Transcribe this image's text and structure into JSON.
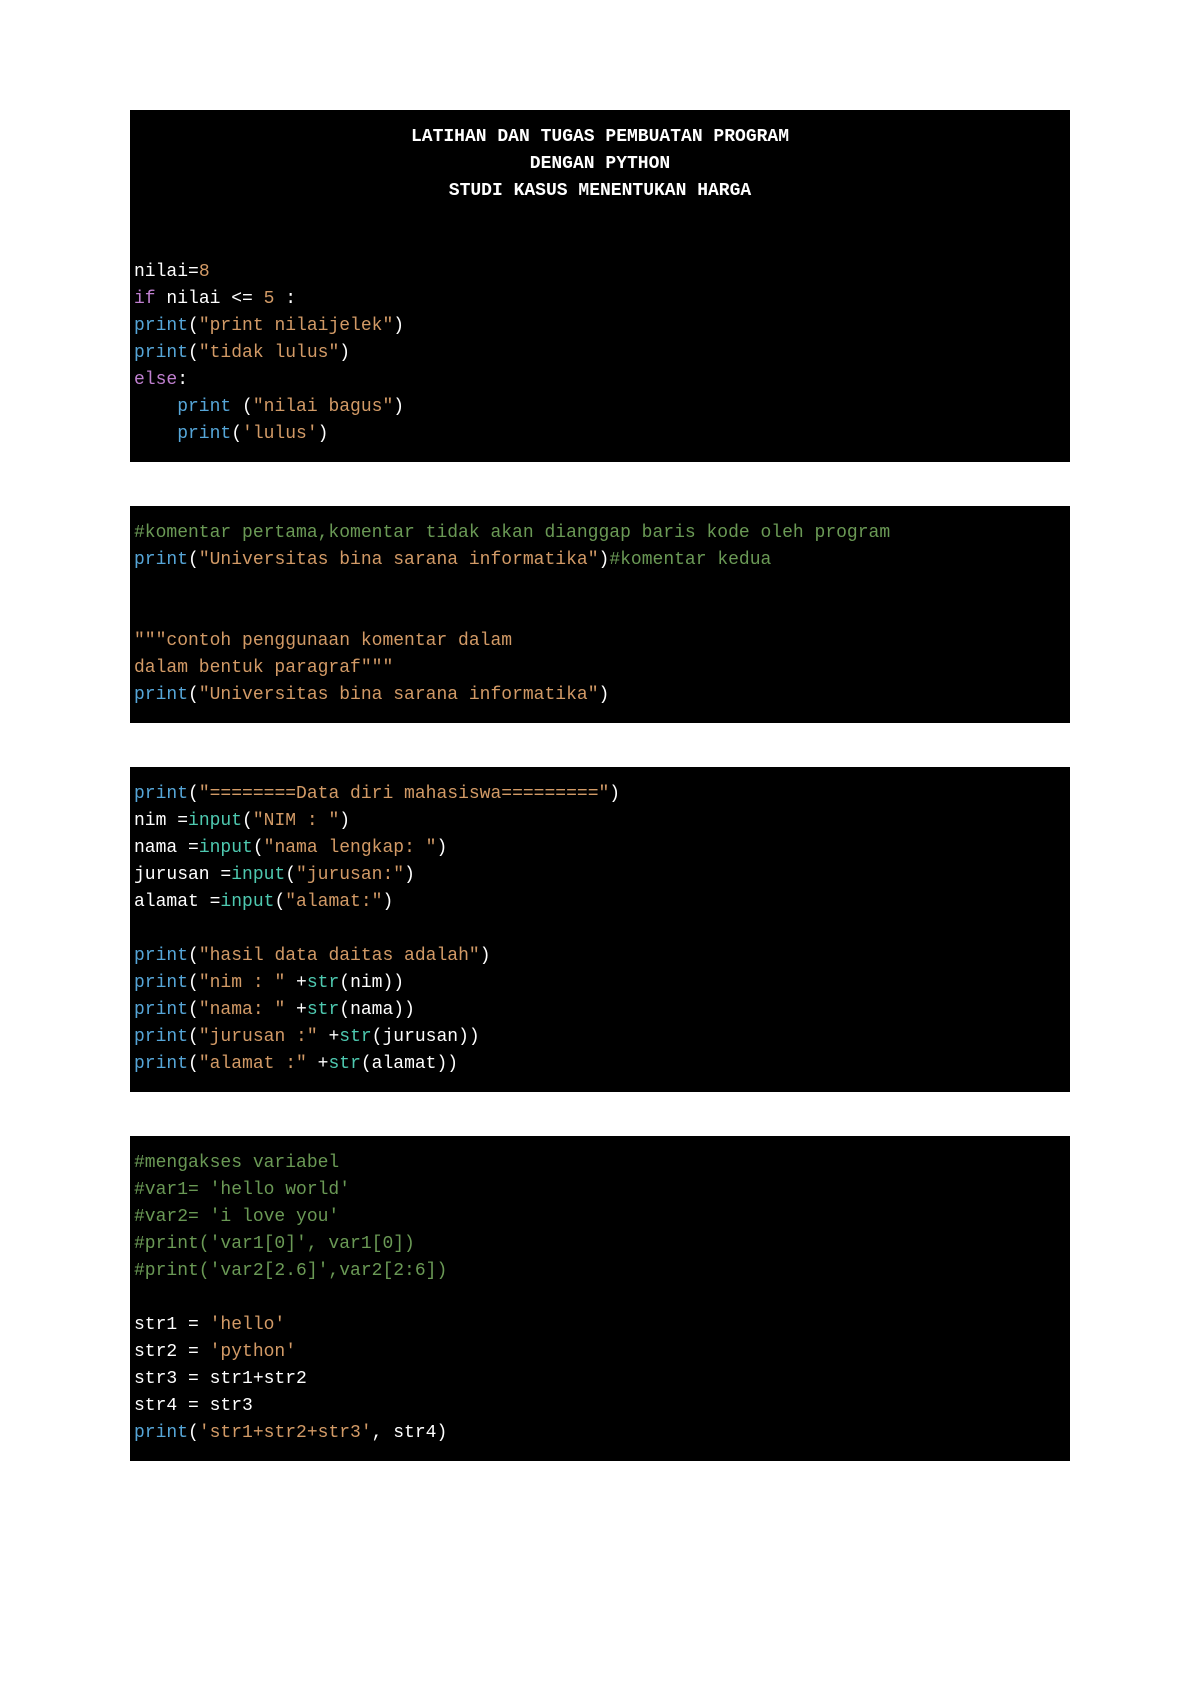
{
  "block1": {
    "title1": "LATIHAN DAN TUGAS PEMBUATAN PROGRAM",
    "title2": "DENGAN PYTHON",
    "title3": "STUDI KASUS MENENTUKAN HARGA",
    "l1_a": "nilai=",
    "l1_b": "8",
    "l2_a": "if",
    "l2_b": " nilai <= ",
    "l2_c": "5",
    "l2_d": " :",
    "l3_a": "print",
    "l3_b": "(",
    "l3_c": "\"print nilaijelek\"",
    "l3_d": ")",
    "l4_a": "print",
    "l4_b": "(",
    "l4_c": "\"tidak lulus\"",
    "l4_d": ")",
    "l5_a": "else",
    "l5_b": ":",
    "l6_a": "    print ",
    "l6_b": "(",
    "l6_c": "\"nilai bagus\"",
    "l6_d": ")",
    "l7_a": "    print",
    "l7_b": "(",
    "l7_c": "'lulus'",
    "l7_d": ")"
  },
  "block2": {
    "l1": "#komentar pertama,komentar tidak akan dianggap baris kode oleh program",
    "l2_a": "print",
    "l2_b": "(",
    "l2_c": "\"Universitas bina sarana informatika\"",
    "l2_d": ")",
    "l2_e": "#komentar kedua",
    "l3_a": "\"\"\"contoh penggunaan komentar dalam",
    "l4_a": "dalam bentuk paragraf\"\"\"",
    "l5_a": "print",
    "l5_b": "(",
    "l5_c": "\"Universitas bina sarana informatika\"",
    "l5_d": ")"
  },
  "block3": {
    "l1_a": "print",
    "l1_b": "(",
    "l1_c": "\"========Data diri mahasiswa=========\"",
    "l1_d": ")",
    "l2_a": "nim =",
    "l2_b": "input",
    "l2_c": "(",
    "l2_d": "\"NIM : \"",
    "l2_e": ")",
    "l3_a": "nama =",
    "l3_b": "input",
    "l3_c": "(",
    "l3_d": "\"nama lengkap: \"",
    "l3_e": ")",
    "l4_a": "jurusan =",
    "l4_b": "input",
    "l4_c": "(",
    "l4_d": "\"jurusan:\"",
    "l4_e": ")",
    "l5_a": "alamat =",
    "l5_b": "input",
    "l5_c": "(",
    "l5_d": "\"alamat:\"",
    "l5_e": ")",
    "l6_a": "print",
    "l6_b": "(",
    "l6_c": "\"hasil data daitas adalah\"",
    "l6_d": ")",
    "l7_a": "print",
    "l7_b": "(",
    "l7_c": "\"nim : \"",
    "l7_d": " +",
    "l7_e": "str",
    "l7_f": "(nim))",
    "l8_a": "print",
    "l8_b": "(",
    "l8_c": "\"nama: \"",
    "l8_d": " +",
    "l8_e": "str",
    "l8_f": "(nama))",
    "l9_a": "print",
    "l9_b": "(",
    "l9_c": "\"jurusan :\"",
    "l9_d": " +",
    "l9_e": "str",
    "l9_f": "(jurusan))",
    "l10_a": "print",
    "l10_b": "(",
    "l10_c": "\"alamat :\"",
    "l10_d": " +",
    "l10_e": "str",
    "l10_f": "(alamat))"
  },
  "block4": {
    "l1": "#mengakses variabel",
    "l2": "#var1= 'hello world'",
    "l3": "#var2= 'i love you'",
    "l4": "#print('var1[0]', var1[0])",
    "l5": "#print('var2[2.6]',var2[2:6])",
    "l6_a": "str1 = ",
    "l6_b": "'hello'",
    "l7_a": "str2 = ",
    "l7_b": "'python'",
    "l8": "str3 = str1+str2",
    "l9": "str4 = str3",
    "l10_a": "print",
    "l10_b": "(",
    "l10_c": "'str1+str2+str3'",
    "l10_d": ", str4)"
  }
}
